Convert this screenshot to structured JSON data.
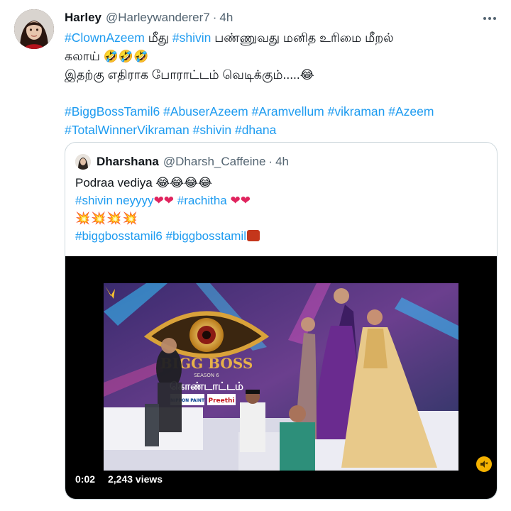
{
  "tweet": {
    "author_name": "Harley",
    "author_handle": "@Harleywanderer7",
    "separator": "·",
    "time": "4h",
    "lines": [
      [
        {
          "text": "#ClownAzeem",
          "tag": true
        },
        {
          "text": " மீது ",
          "tag": false
        },
        {
          "text": "#shivin",
          "tag": true
        },
        {
          "text": " பண்ணுவது மனித உரிமை மீறல்",
          "tag": false
        }
      ],
      [
        {
          "text": "கலாய் ",
          "tag": false
        },
        {
          "text": "🤣🤣🤣",
          "tag": false,
          "emoji": true
        }
      ],
      [
        {
          "text": "இதற்கு எதிராக போராட்டம் வெடிக்கும்.....",
          "tag": false
        },
        {
          "text": "😂",
          "tag": false,
          "emoji": true
        }
      ],
      [],
      [
        {
          "text": "#BiggBossTamil6",
          "tag": true
        },
        {
          "text": " ",
          "tag": false
        },
        {
          "text": "#AbuserAzeem",
          "tag": true
        },
        {
          "text": " ",
          "tag": false
        },
        {
          "text": "#Aramvellum",
          "tag": true
        },
        {
          "text": " ",
          "tag": false
        },
        {
          "text": "#vikraman",
          "tag": true
        },
        {
          "text": " ",
          "tag": false
        },
        {
          "text": "#Azeem",
          "tag": true
        }
      ],
      [
        {
          "text": "#TotalWinnerVikraman",
          "tag": true
        },
        {
          "text": " ",
          "tag": false
        },
        {
          "text": "#shivin",
          "tag": true
        },
        {
          "text": " ",
          "tag": false
        },
        {
          "text": "#dhana",
          "tag": true
        }
      ]
    ]
  },
  "quote": {
    "author_name": "Dharshana",
    "author_handle": "@Dharsh_Caffeine",
    "separator": "·",
    "time": "4h",
    "line1": "Podraa vediya ",
    "line1_emoji": "😂😂😂😂",
    "line2_tag1": "#shivin neyyyy",
    "line2_hearts1": "❤❤",
    "line2_tag2": "#rachitha",
    "line2_hearts2": "❤❤",
    "line3_bursts": "💥💥💥💥",
    "line4_tag1": "#biggbosstamil6",
    "line4_tag2": "#biggbosstamil",
    "video": {
      "timecode": "0:02",
      "views": "2,243 views",
      "logo_text": "BIGG BOSS",
      "season_text": "SEASON 6",
      "subtitle_tamil": "கொண்டாட்டம்",
      "sponsor1": "NIPPON PAINT",
      "sponsor2": "Preethi"
    }
  },
  "colors": {
    "link": "#1d9bf0",
    "text": "#0f1419",
    "muted": "#536471",
    "border": "#cfd9de"
  }
}
